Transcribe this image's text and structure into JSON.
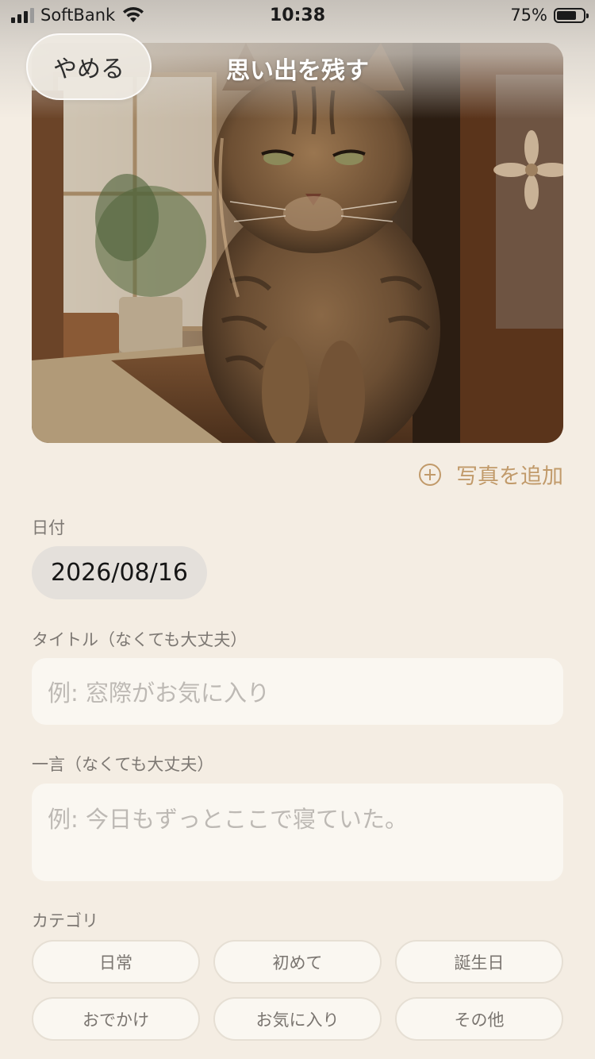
{
  "status_bar": {
    "carrier": "SoftBank",
    "time": "10:38",
    "battery_percent": "75%",
    "battery_level": 0.75,
    "icons": [
      "cellular-signal-icon",
      "wifi-icon",
      "battery-icon"
    ]
  },
  "header": {
    "cancel_label": "やめる",
    "title": "思い出を残す"
  },
  "photo": {
    "subject": "tabby-cat-photo"
  },
  "add_photo": {
    "label": "写真を追加",
    "icon": "plus-circle-icon"
  },
  "date": {
    "label": "日付",
    "value": "2026/08/16"
  },
  "title_field": {
    "label": "タイトル（なくても大丈夫）",
    "placeholder": "例: 窓際がお気に入り"
  },
  "comment_field": {
    "label": "一言（なくても大丈夫）",
    "placeholder": "例: 今日もずっとここで寝ていた。"
  },
  "category": {
    "label": "カテゴリ",
    "options": [
      "日常",
      "初めて",
      "誕生日",
      "おでかけ",
      "お気に入り",
      "その他"
    ]
  },
  "colors": {
    "background": "#f4ede3",
    "accent": "#c19a6a",
    "field_background": "#faf7f1",
    "date_pill": "#e4e0db"
  }
}
